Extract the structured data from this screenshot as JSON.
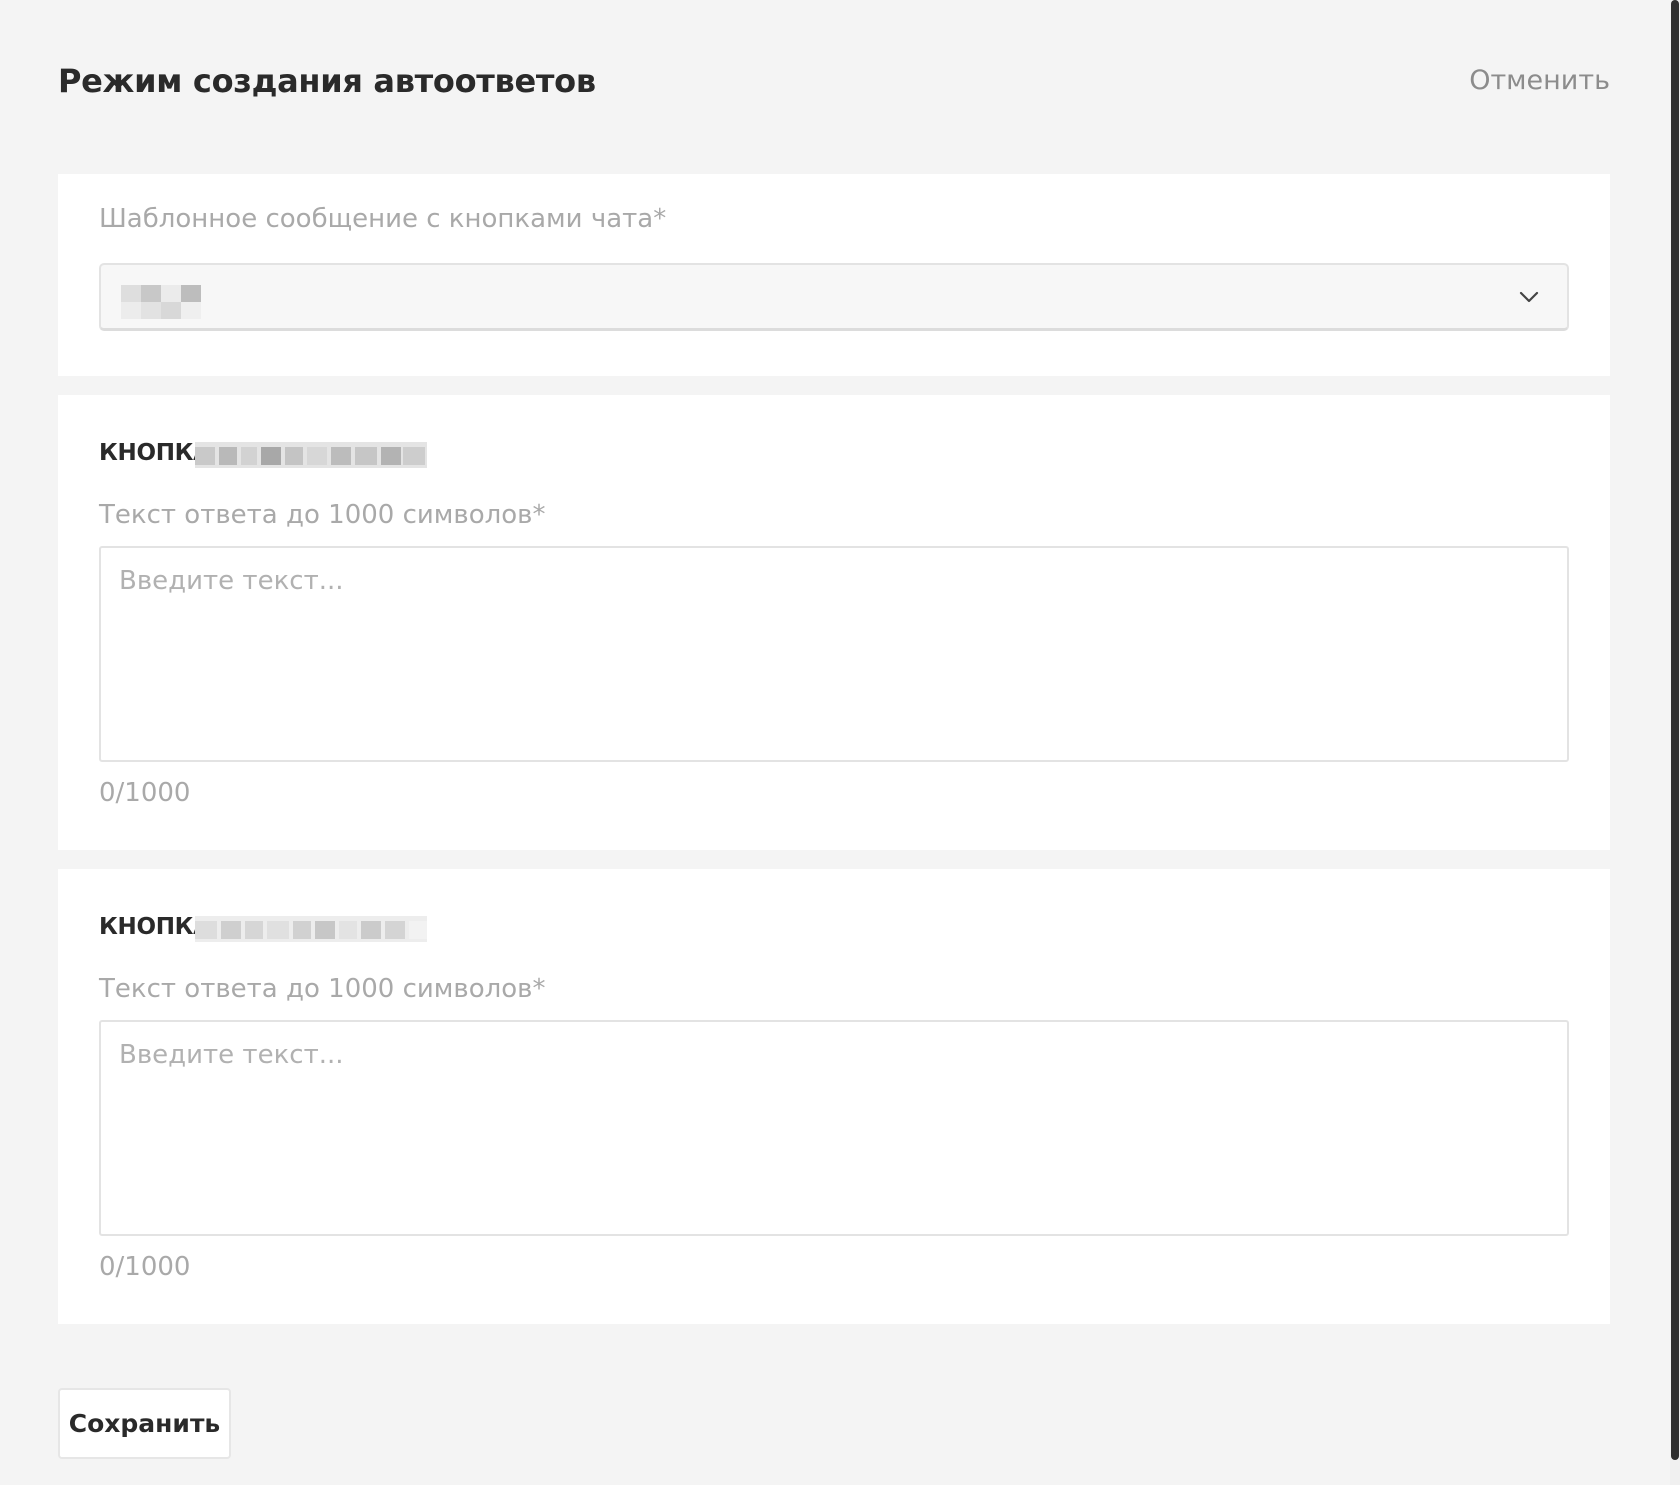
{
  "header": {
    "title": "Режим создания автоответов",
    "cancel_label": "Отменить"
  },
  "template_section": {
    "label": "Шаблонное сообщение с кнопками чата*",
    "selected_value_redacted": true
  },
  "buttons": [
    {
      "title_prefix": "КНОПКА",
      "name_redacted": true,
      "field_label": "Текст ответа до 1000 символов*",
      "placeholder": "Введите текст...",
      "value": "",
      "counter": "0/1000"
    },
    {
      "title_prefix": "КНОПКА",
      "name_redacted": true,
      "field_label": "Текст ответа до 1000 символов*",
      "placeholder": "Введите текст...",
      "value": "",
      "counter": "0/1000"
    }
  ],
  "footer": {
    "save_label": "Сохранить"
  },
  "icons": {
    "select_toggle": "chevron-down-icon"
  },
  "colors": {
    "background": "#f4f4f4",
    "card": "#ffffff",
    "muted_text": "#a9a9a9",
    "title_text": "#2a2a2a"
  }
}
